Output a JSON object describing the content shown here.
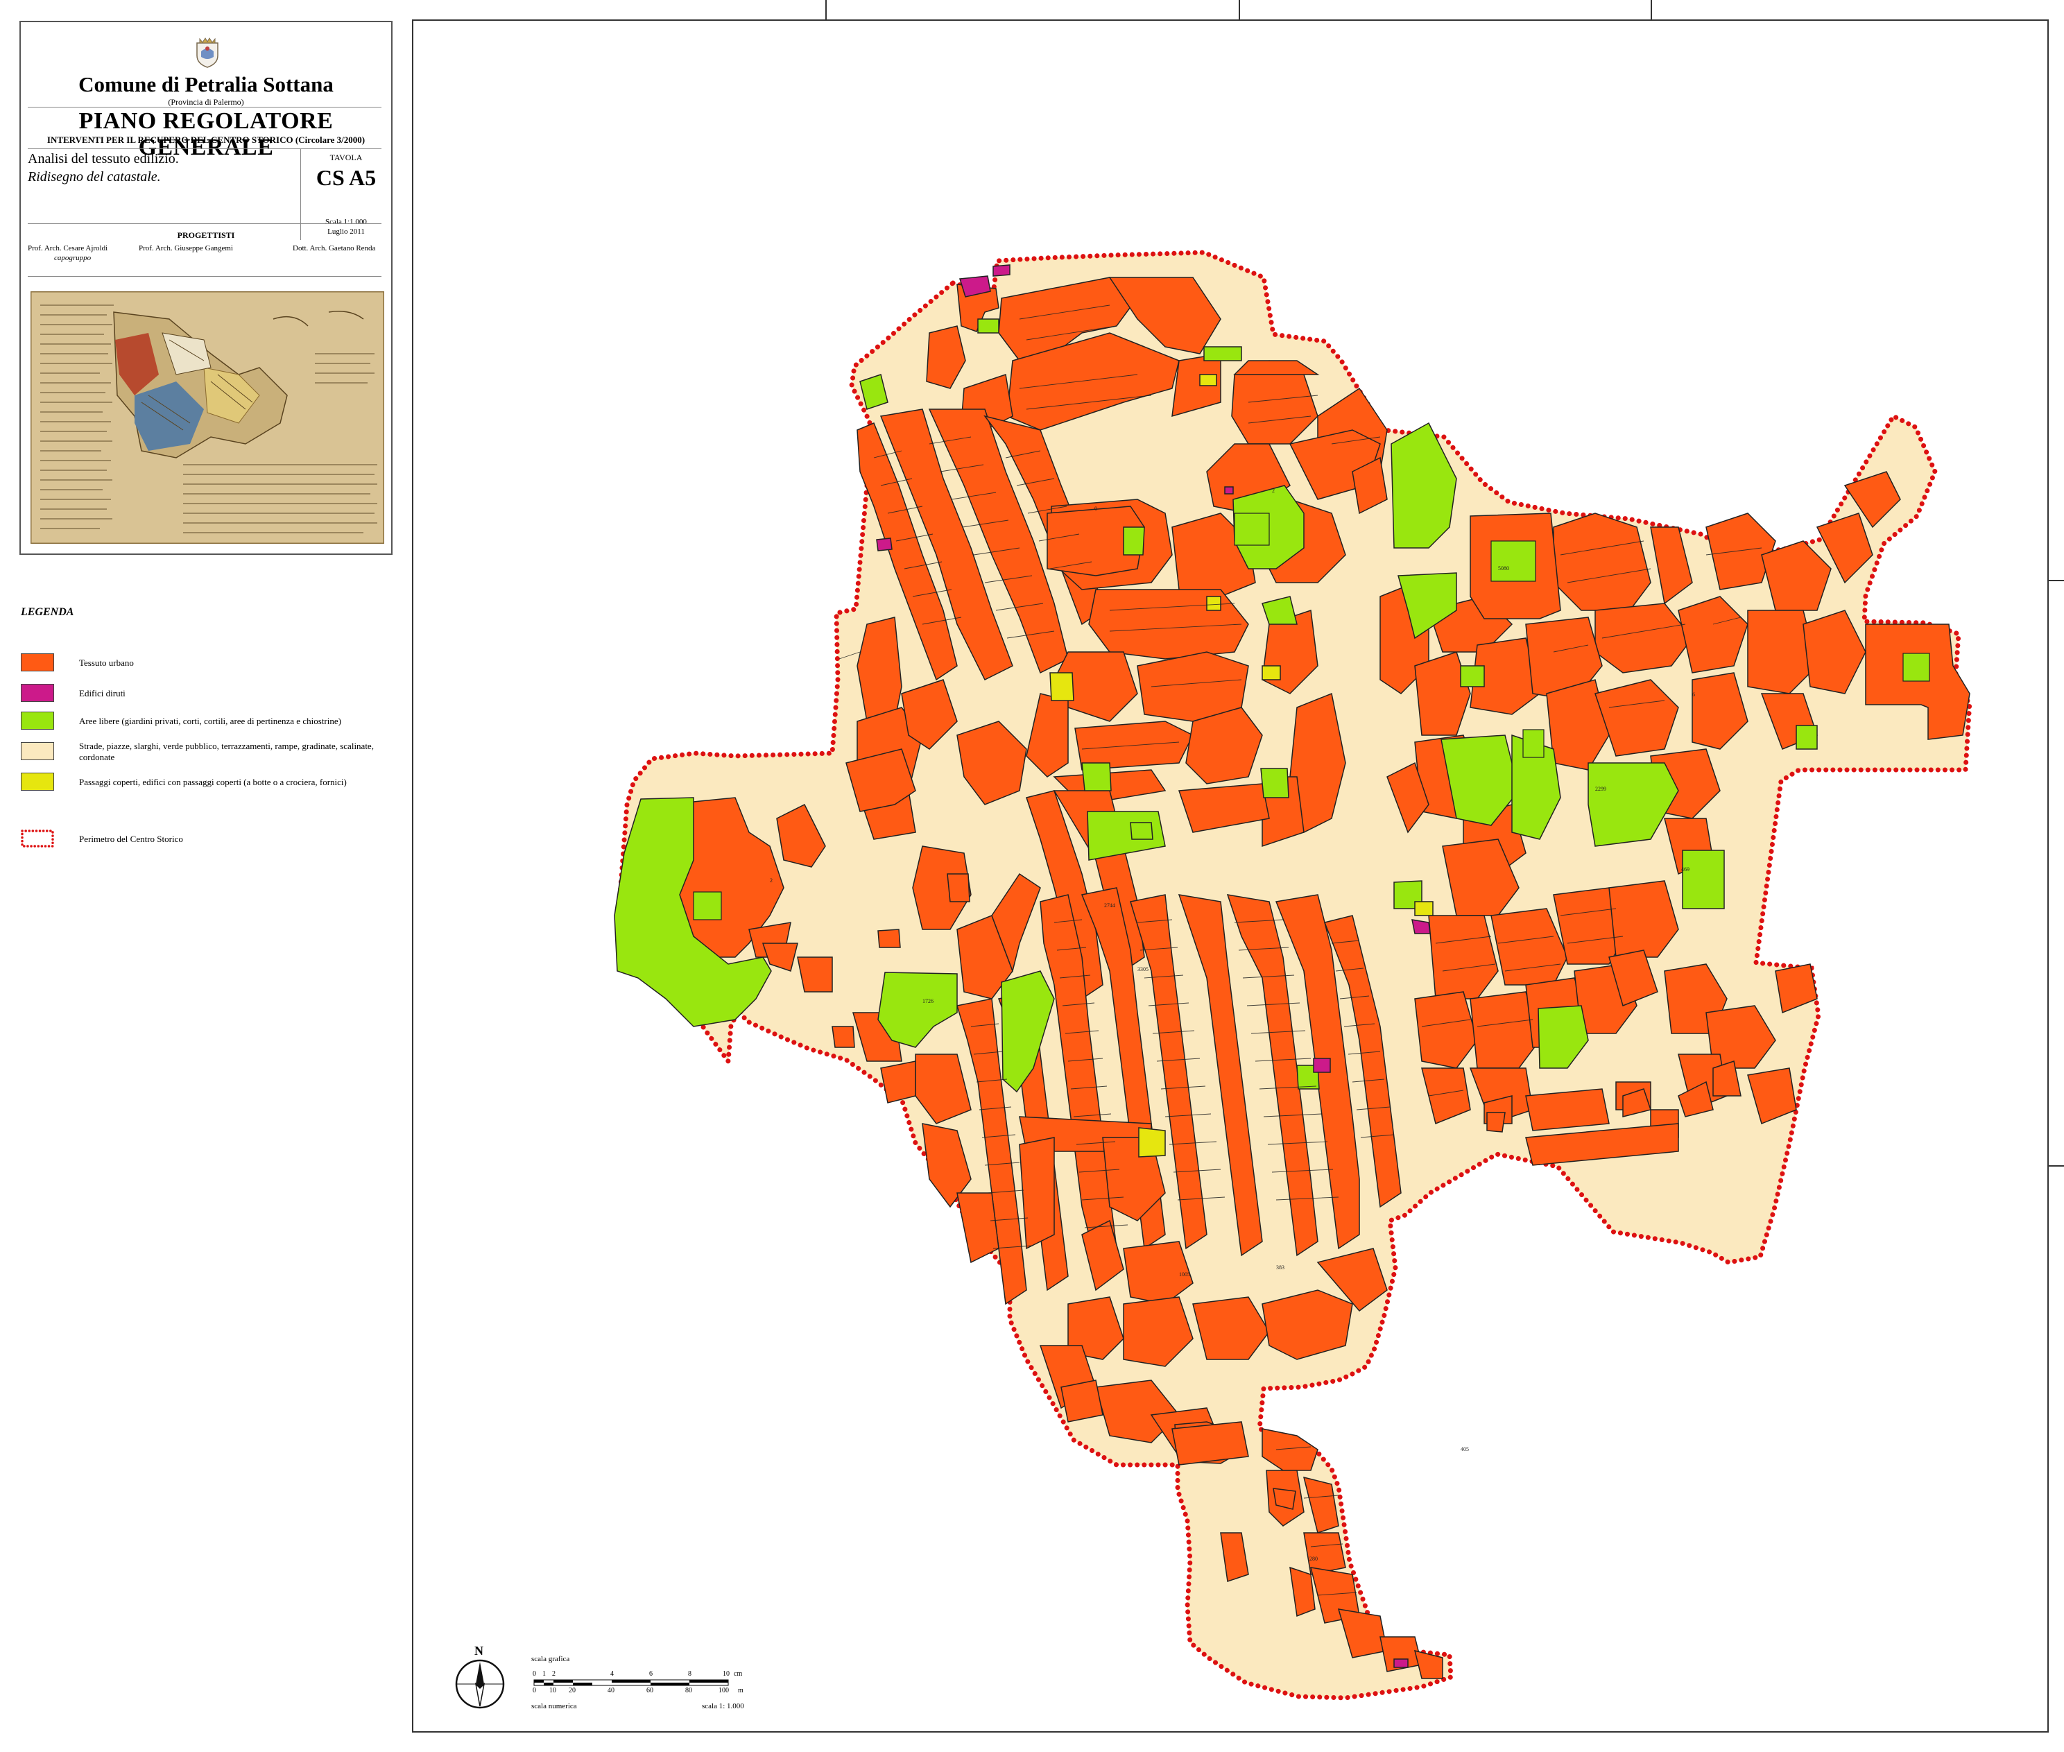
{
  "title_block": {
    "comune": "Comune di Petralia Sottana",
    "provincia": "(Provincia di Palermo)",
    "piano": "PIANO REGOLATORE GENERALE",
    "interventi": "INTERVENTI PER IL RECUPERO DEL CENTRO STORICO (Circolare 3/2000)",
    "analisi": "Analisi del tessuto edilizio.",
    "ridisegno": "Ridisegno del catastale.",
    "tavola_label": "TAVOLA",
    "tavola_code": "CS A5",
    "scala": "Scala 1:1.000",
    "data": "Luglio 2011",
    "progettisti_label": "PROGETTISTI",
    "progettisti": [
      {
        "name": "Prof. Arch. Cesare Ajroldi",
        "role": "capogruppo"
      },
      {
        "name": "Prof. Arch. Giuseppe Gangemi",
        "role": ""
      },
      {
        "name": "Dott. Arch. Gaetano Renda",
        "role": ""
      }
    ]
  },
  "legend": {
    "title": "LEGENDA",
    "items": [
      {
        "label": "Tessuto urbano",
        "color": "#ff5a14"
      },
      {
        "label": "Edifici diruti",
        "color": "#cc1a8a"
      },
      {
        "label": "Aree libere (giardini privati, corti, cortili, aree di pertinenza e  chiostrine)",
        "color": "#99e60f"
      },
      {
        "label": "Strade, piazze, slarghi, verde pubblico, terrazzamenti, rampe, gradinate, scalinate, cordonate",
        "color": "#fbe9bf"
      },
      {
        "label": "Passaggi coperti, edifici con passaggi coperti (a botte o a crociera, fornici)",
        "color": "#e6e60f"
      },
      {
        "label": "Perimetro del Centro Storico",
        "color": "#dd1111"
      }
    ]
  },
  "map": {
    "colors": {
      "tessuto": "#ff5a14",
      "diruti": "#cc1a8a",
      "libere": "#99e60f",
      "strade": "#fbe9bf",
      "passaggi": "#e6e60f",
      "perimetro": "#dd1111",
      "outline": "#222222"
    }
  },
  "north": {
    "letter": "N"
  },
  "scale_bar": {
    "label_top": "scala grafica",
    "label_bottom": "scala numerica",
    "value": "scala  1: 1.000",
    "cm_ticks": [
      "0",
      "1",
      "2",
      "4",
      "6",
      "8",
      "10"
    ],
    "cm_unit": "cm",
    "m_ticks": [
      "0",
      "10",
      "20",
      "40",
      "60",
      "80",
      "100"
    ],
    "m_unit": "m"
  }
}
